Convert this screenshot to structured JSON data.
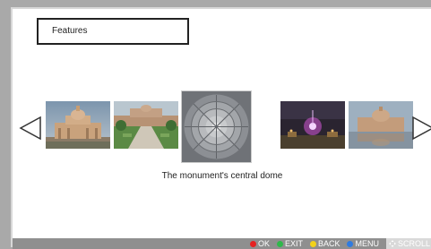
{
  "title": "Features",
  "caption": "The monument's central dome",
  "thumbnails": [
    {
      "icon": "temple-facade-image"
    },
    {
      "icon": "garden-courtyard-image"
    },
    {
      "icon": "dome-interior-image"
    },
    {
      "icon": "night-lights-image"
    },
    {
      "icon": "temple-reflection-image"
    }
  ],
  "legend": {
    "ok": {
      "label": "OK",
      "color": "#e52222"
    },
    "exit": {
      "label": "EXIT",
      "color": "#2fb84a"
    },
    "back": {
      "label": "BACK",
      "color": "#f2d21a"
    },
    "menu": {
      "label": "MENU",
      "color": "#2f7be0"
    },
    "scroll": {
      "label": "SCROLL"
    }
  },
  "colors": {
    "background": "#a9a9a9",
    "panel": "#ffffff",
    "bottom_bar": "#8f8f8f"
  }
}
